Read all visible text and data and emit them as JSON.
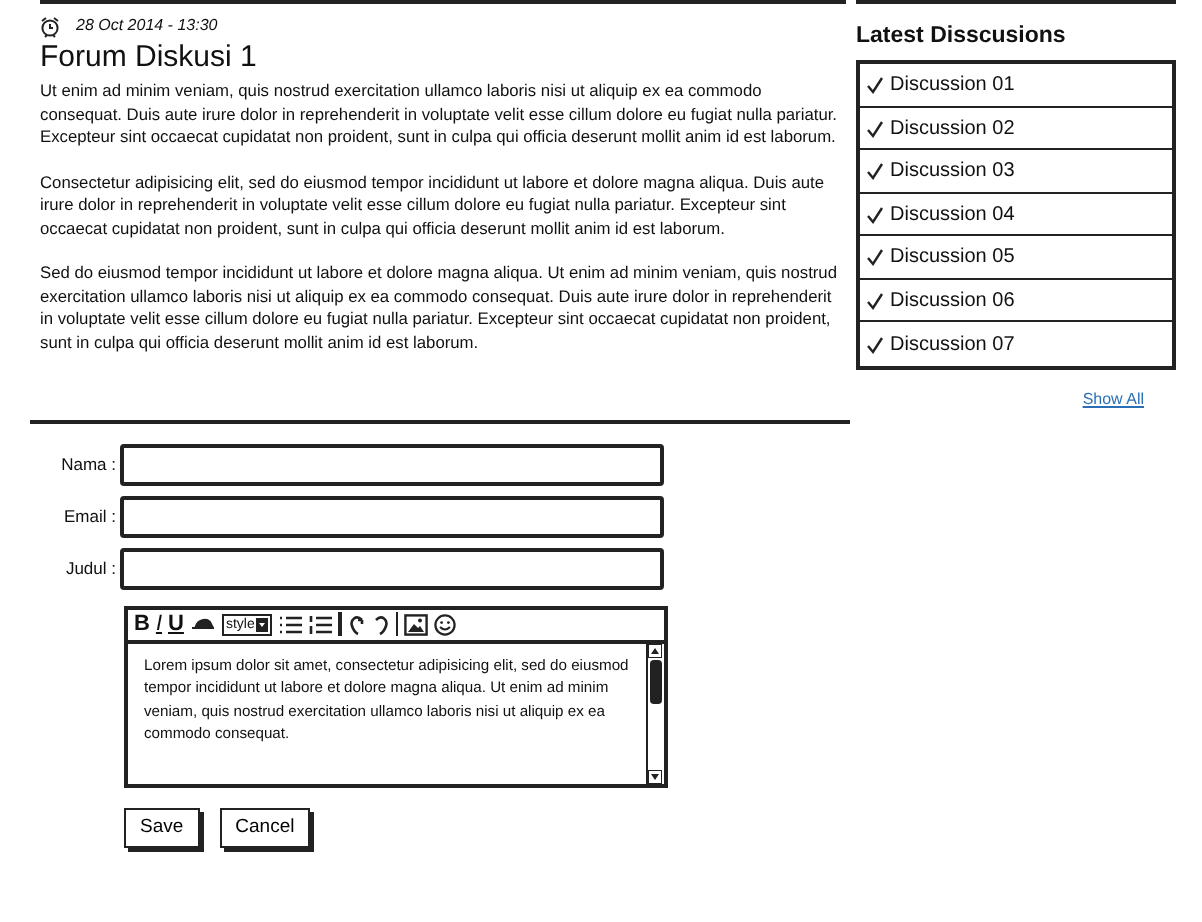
{
  "post": {
    "date": "28 Oct 2014 - 13:30",
    "title": "Forum Diskusi 1",
    "paragraphs": [
      "Ut enim ad minim veniam, quis nostrud exercitation ullamco laboris nisi ut aliquip ex ea commodo consequat. Duis aute irure dolor in reprehenderit in voluptate velit esse cillum dolore eu fugiat nulla pariatur. Excepteur sint occaecat cupidatat non proident, sunt in culpa qui officia deserunt mollit anim id est laborum.",
      "Consectetur adipisicing elit, sed do eiusmod tempor incididunt ut labore et dolore magna aliqua. Duis aute irure dolor in reprehenderit in voluptate velit esse cillum dolore eu fugiat nulla pariatur. Excepteur sint occaecat cupidatat non proident, sunt in culpa qui officia deserunt mollit anim id est laborum.",
      "Sed do eiusmod tempor incididunt ut labore et dolore magna aliqua. Ut enim ad minim veniam, quis nostrud exercitation ullamco laboris nisi ut aliquip ex ea commodo consequat. Duis aute irure dolor in reprehenderit in voluptate velit esse cillum dolore eu fugiat nulla pariatur. Excepteur sint occaecat cupidatat non proident, sunt in culpa qui officia deserunt mollit anim id est laborum."
    ]
  },
  "sidebar": {
    "title": "Latest Disscusions",
    "items": [
      {
        "label": "Discussion 01",
        "checked": true
      },
      {
        "label": "Discussion 02",
        "checked": true
      },
      {
        "label": "Discussion 03",
        "checked": true
      },
      {
        "label": "Discussion 04",
        "checked": true
      },
      {
        "label": "Discussion 05",
        "checked": true
      },
      {
        "label": "Discussion 06",
        "checked": true
      },
      {
        "label": "Discussion 07",
        "checked": true
      }
    ],
    "link": "Show All"
  },
  "form": {
    "fields": [
      {
        "label": "Nama :"
      },
      {
        "label": "Email :"
      },
      {
        "label": "Judul :"
      }
    ],
    "toolbar": [
      {
        "kind": "bold",
        "label": "B"
      },
      {
        "kind": "italic",
        "label": "I"
      },
      {
        "kind": "underline",
        "label": "U"
      },
      {
        "kind": "color"
      },
      {
        "kind": "dropdown",
        "label": "style"
      },
      {
        "kind": "bullets"
      },
      {
        "kind": "numbers"
      },
      {
        "kind": "separator"
      },
      {
        "kind": "undo"
      },
      {
        "kind": "redo"
      },
      {
        "kind": "separator"
      },
      {
        "kind": "image"
      },
      {
        "kind": "smiley"
      }
    ],
    "editor_text": "Lorem ipsum dolor sit amet, consectetur adipisicing elit, sed do eiusmod tempor incididunt ut labore et dolore magna aliqua. Ut enim ad minim veniam, quis nostrud exercitation ullamco laboris nisi ut aliquip ex ea commodo consequat.",
    "buttons": [
      "Save",
      "Cancel"
    ]
  }
}
